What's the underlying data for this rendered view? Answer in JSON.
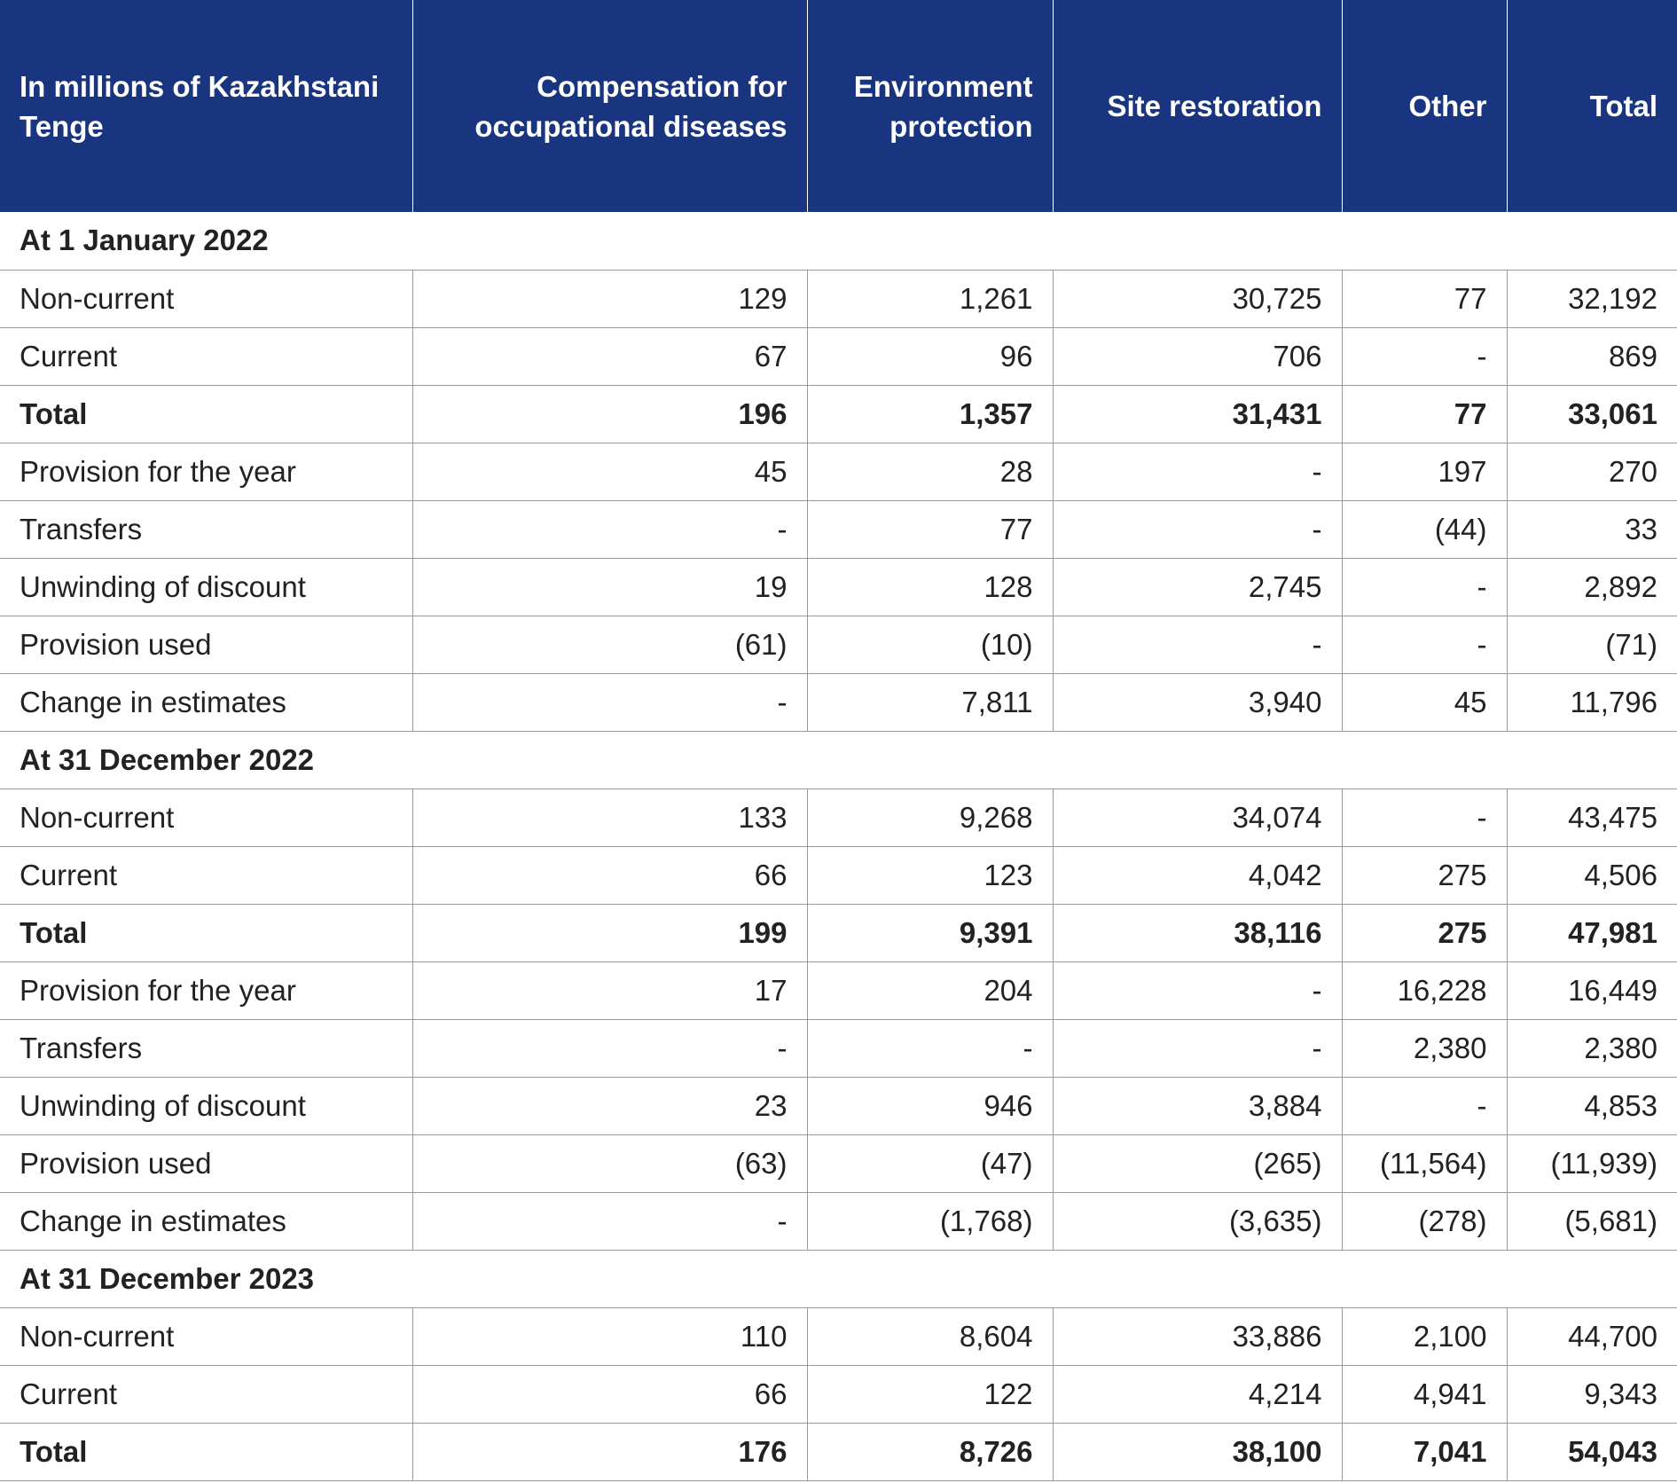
{
  "table": {
    "headers": [
      "In millions of Kazakhstani Tenge",
      "Compensation for occupational diseases",
      "Environment protection",
      "Site restoration",
      "Other",
      "Total"
    ],
    "rows": [
      {
        "type": "section",
        "label": "At 1 January 2022"
      },
      {
        "type": "data",
        "label": "Non-current",
        "values": [
          "129",
          "1,261",
          "30,725",
          "77",
          "32,192"
        ]
      },
      {
        "type": "data",
        "label": "Current",
        "values": [
          "67",
          "96",
          "706",
          "-",
          "869"
        ]
      },
      {
        "type": "total",
        "label": "Total",
        "values": [
          "196",
          "1,357",
          "31,431",
          "77",
          "33,061"
        ]
      },
      {
        "type": "data",
        "label": "Provision for the year",
        "values": [
          "45",
          "28",
          "-",
          "197",
          "270"
        ]
      },
      {
        "type": "data",
        "label": "Transfers",
        "values": [
          "-",
          "77",
          "-",
          "(44)",
          "33"
        ]
      },
      {
        "type": "data",
        "label": "Unwinding of discount",
        "values": [
          "19",
          "128",
          "2,745",
          "-",
          "2,892"
        ]
      },
      {
        "type": "data",
        "label": "Provision used",
        "values": [
          "(61)",
          "(10)",
          "-",
          "-",
          "(71)"
        ]
      },
      {
        "type": "data",
        "label": "Change in estimates",
        "values": [
          "-",
          "7,811",
          "3,940",
          "45",
          "11,796"
        ]
      },
      {
        "type": "section",
        "label": "At 31 December 2022"
      },
      {
        "type": "data",
        "label": "Non-current",
        "values": [
          "133",
          "9,268",
          "34,074",
          "-",
          "43,475"
        ]
      },
      {
        "type": "data",
        "label": "Current",
        "values": [
          "66",
          "123",
          "4,042",
          "275",
          "4,506"
        ]
      },
      {
        "type": "total",
        "label": "Total",
        "values": [
          "199",
          "9,391",
          "38,116",
          "275",
          "47,981"
        ]
      },
      {
        "type": "data",
        "label": "Provision for the year",
        "values": [
          "17",
          "204",
          "-",
          "16,228",
          "16,449"
        ]
      },
      {
        "type": "data",
        "label": "Transfers",
        "values": [
          "-",
          "-",
          "-",
          "2,380",
          "2,380"
        ]
      },
      {
        "type": "data",
        "label": "Unwinding of discount",
        "values": [
          "23",
          "946",
          "3,884",
          "-",
          "4,853"
        ]
      },
      {
        "type": "data",
        "label": "Provision used",
        "values": [
          "(63)",
          "(47)",
          "(265)",
          "(11,564)",
          "(11,939)"
        ]
      },
      {
        "type": "data",
        "label": "Change in estimates",
        "values": [
          "-",
          "(1,768)",
          "(3,635)",
          "(278)",
          "(5,681)"
        ]
      },
      {
        "type": "section",
        "label": "At 31 December 2023"
      },
      {
        "type": "data",
        "label": "Non-current",
        "values": [
          "110",
          "8,604",
          "33,886",
          "2,100",
          "44,700"
        ]
      },
      {
        "type": "data",
        "label": "Current",
        "values": [
          "66",
          "122",
          "4,214",
          "4,941",
          "9,343"
        ]
      },
      {
        "type": "total",
        "label": "Total",
        "values": [
          "176",
          "8,726",
          "38,100",
          "7,041",
          "54,043"
        ]
      }
    ]
  }
}
